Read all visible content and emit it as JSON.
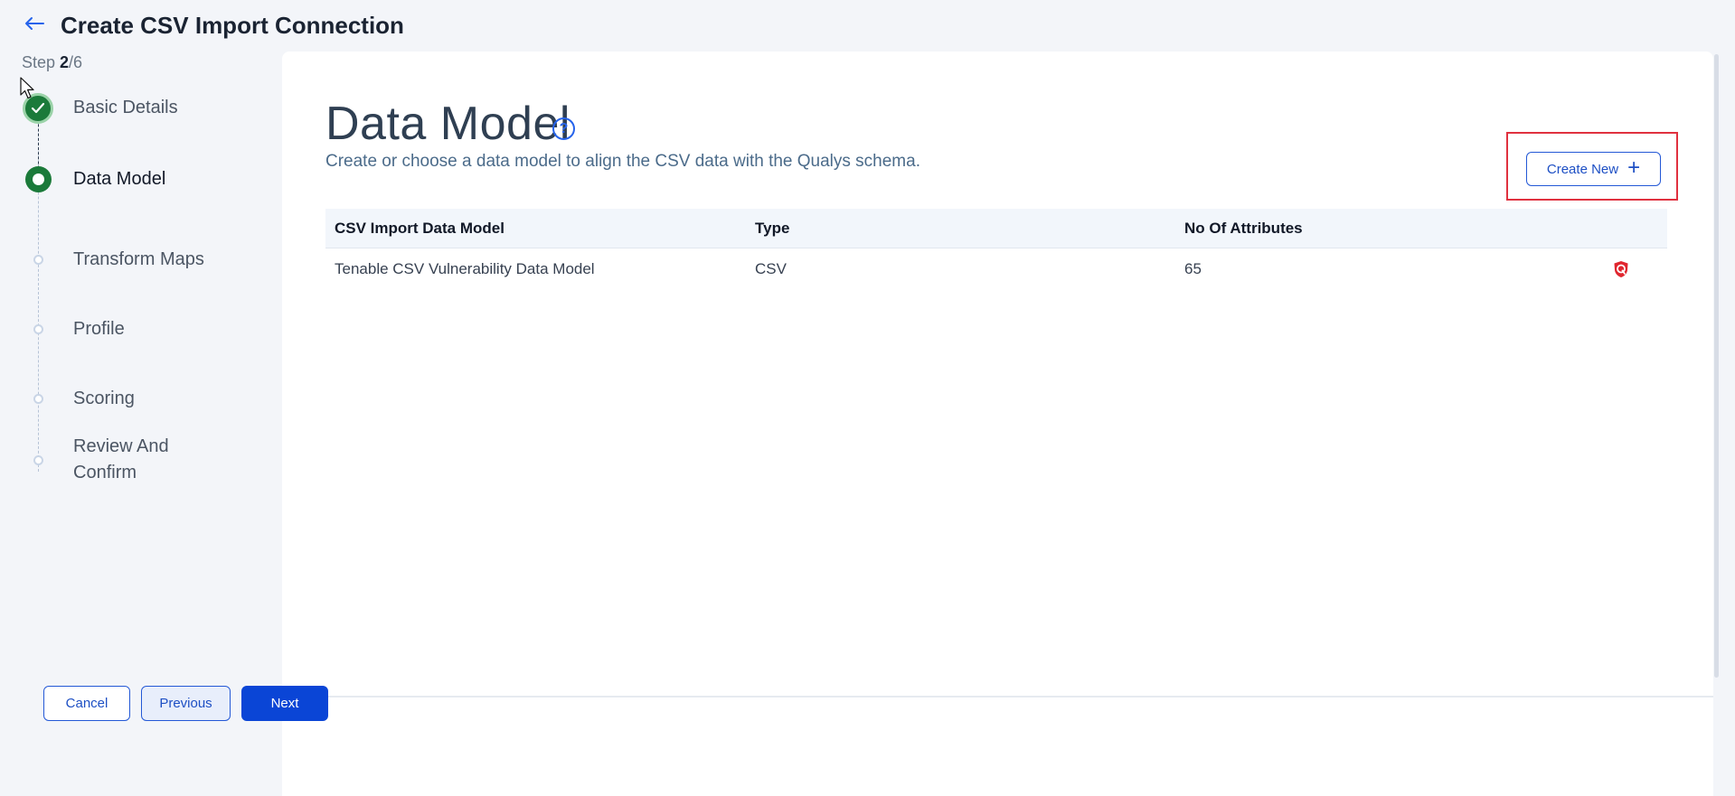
{
  "header": {
    "title": "Create CSV Import Connection"
  },
  "sidebar": {
    "step_prefix": "Step ",
    "step_current": "2",
    "step_total": "/6",
    "steps": [
      {
        "label": "Basic Details",
        "status": "done"
      },
      {
        "label": "Data Model",
        "status": "current"
      },
      {
        "label": "Transform Maps",
        "status": "pending"
      },
      {
        "label": "Profile",
        "status": "pending"
      },
      {
        "label": "Scoring",
        "status": "pending"
      },
      {
        "label": "Review And Confirm",
        "status": "pending"
      }
    ]
  },
  "main": {
    "title": "Data Model",
    "help_icon": "?",
    "subtitle": "Create or choose a data model to align the CSV data with the Qualys schema.",
    "create_button": "Create New",
    "create_button_icon": "+",
    "table": {
      "headers": [
        "CSV Import Data Model",
        "Type",
        "No Of Attributes"
      ],
      "rows": [
        {
          "name": "Tenable CSV Vulnerability Data Model",
          "type": "CSV",
          "attributes": "65",
          "icon": "qualys-shield-icon"
        }
      ]
    }
  },
  "footer": {
    "cancel": "Cancel",
    "previous": "Previous",
    "next": "Next"
  },
  "colors": {
    "accent": "#0a45d6",
    "success": "#1b7a3a",
    "highlight": "#e0313f",
    "brand_icon": "#e0262f"
  }
}
